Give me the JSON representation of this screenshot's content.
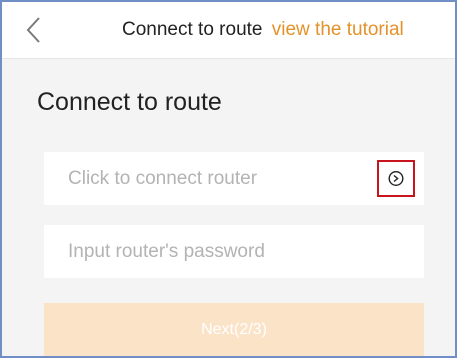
{
  "header": {
    "back_icon": "chevron-left-icon",
    "title": "Connect to route",
    "tutorial_link": "view the tutorial"
  },
  "main": {
    "title": "Connect to route",
    "router_field": {
      "placeholder": "Click to connect router",
      "action_icon": "circle-arrow-right-icon"
    },
    "password_field": {
      "placeholder": "Input router's password"
    },
    "next_button": "Next(2/3)"
  },
  "colors": {
    "accent": "#e4922a",
    "next_button_bg": "#fbe3c8",
    "highlight_border": "#c8141c",
    "page_bg": "#f4f4f4"
  }
}
